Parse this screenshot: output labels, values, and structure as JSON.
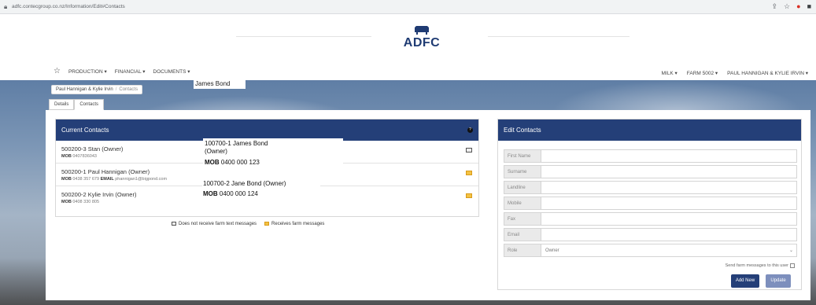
{
  "browser": {
    "url": "adfc.contecgroup.co.nz/Information/Edit#Contacts"
  },
  "logo": {
    "text": "ADFC"
  },
  "nav": {
    "left": [
      "PRODUCTION ▾",
      "FINANCIAL ▾",
      "DOCUMENTS ▾"
    ],
    "right": [
      "MILK ▾",
      "FARM 5002 ▾",
      "PAUL HANNIGAN & KYLIE IRVIN ▾"
    ]
  },
  "breadcrumb": {
    "parent": "Paul Hannigan & Kylie Irvin",
    "separator": "/",
    "current": "Contacts"
  },
  "overlay_name": "James Bond",
  "tabs": [
    "Details",
    "Contacts"
  ],
  "current_contacts": {
    "title": "Current Contacts",
    "help_icon": "?",
    "contacts": [
      {
        "name": "500200-3 Stan (Owner)",
        "mob_label": "MOB",
        "mob": "0407836043",
        "email_label": "",
        "email": "",
        "receives_messages": false
      },
      {
        "name": "500200-1 Paul Hannigan (Owner)",
        "mob_label": "MOB",
        "mob": "0438 357 679",
        "email_label": "EMAIL",
        "email": "phannigan1@bigpond.com",
        "receives_messages": true
      },
      {
        "name": "500200-2 Kylie Irvin (Owner)",
        "mob_label": "MOB",
        "mob": "0408 330 805",
        "email_label": "",
        "email": "",
        "receives_messages": true
      }
    ],
    "legend": {
      "no_messages": "Does not receive farm text messages",
      "messages": "Receives farm messages"
    }
  },
  "overlays": [
    {
      "line1": "100700-1  James Bond",
      "line2": "(Owner)",
      "mob_label": "MOB",
      "mob": "0400 000 123"
    },
    {
      "line1": "100700-2  Jane Bond (Owner)",
      "mob_label": "MOB",
      "mob": "0400 000 124"
    }
  ],
  "edit_contacts": {
    "title": "Edit Contacts",
    "fields": [
      {
        "label": "First Name",
        "value": ""
      },
      {
        "label": "Surname",
        "value": ""
      },
      {
        "label": "Landline",
        "value": ""
      },
      {
        "label": "Mobile",
        "value": ""
      },
      {
        "label": "Fax",
        "value": ""
      },
      {
        "label": "Email",
        "value": ""
      },
      {
        "label": "Role",
        "value": "Owner"
      }
    ],
    "send_label": "Send farm messages to this user",
    "add_button": "Add New",
    "update_button": "Update"
  },
  "colors": {
    "header_blue": "#243f78",
    "gold": "#f3c243"
  }
}
